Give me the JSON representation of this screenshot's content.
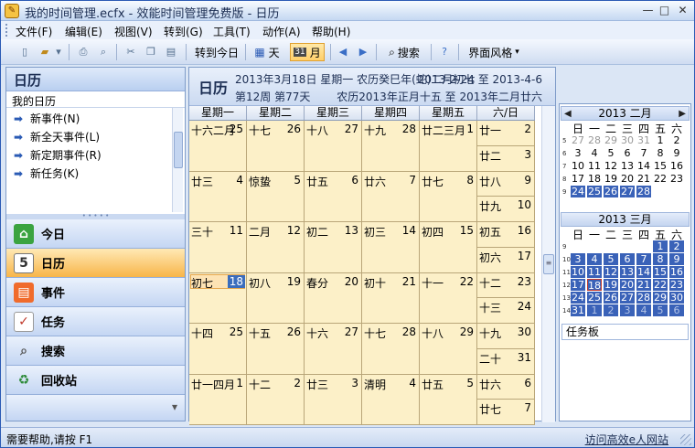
{
  "window": {
    "title": "我的时间管理.ecfx - 效能时间管理免费版 - 日历",
    "min": "—",
    "max": "□",
    "close": "✕"
  },
  "menu": [
    "文件(F)",
    "编辑(E)",
    "视图(V)",
    "转到(G)",
    "工具(T)",
    "动作(A)",
    "帮助(H)"
  ],
  "toolbar": {
    "goto_today": "转到今日",
    "day": "天",
    "month": "月",
    "month_icon": "31",
    "search": "搜索",
    "skin": "界面风格"
  },
  "left": {
    "title": "日历",
    "subtitle": "我的日历",
    "items": [
      "新事件(N)",
      "新全天事件(L)",
      "新定期事件(R)",
      "新任务(K)"
    ],
    "nav": [
      "今日",
      "日历",
      "事件",
      "任务",
      "搜索",
      "回收站"
    ]
  },
  "main": {
    "title": "日历",
    "info1": "2013年3月18日 星期一 农历癸巳年(蛇)二月初七",
    "info2": "第12周 第77天",
    "range": "2013-2-24 至 2013-4-6",
    "lunar_range": "农历2013年正月十五 至 2013年二月廿六",
    "weekdays": [
      "星期一",
      "星期二",
      "星期三",
      "星期四",
      "星期五",
      "六/日"
    ],
    "weeks": [
      {
        "cells": [
          [
            "十六二月",
            "25"
          ],
          [
            "十七",
            "26"
          ],
          [
            "十八",
            "27"
          ],
          [
            "十九",
            "28"
          ],
          [
            "廿二三月",
            "1"
          ]
        ],
        "sat": [
          "廿一",
          "2"
        ],
        "sun": [
          "廿二",
          "3"
        ]
      },
      {
        "cells": [
          [
            "廿三",
            "4"
          ],
          [
            "惊蛰",
            "5"
          ],
          [
            "廿五",
            "6"
          ],
          [
            "廿六",
            "7"
          ],
          [
            "廿七",
            "8"
          ]
        ],
        "sat": [
          "廿八",
          "9"
        ],
        "sun": [
          "廿九",
          "10"
        ]
      },
      {
        "cells": [
          [
            "三十",
            "11"
          ],
          [
            "二月",
            "12"
          ],
          [
            "初二",
            "13"
          ],
          [
            "初三",
            "14"
          ],
          [
            "初四",
            "15"
          ]
        ],
        "sat": [
          "初五",
          "16"
        ],
        "sun": [
          "初六",
          "17"
        ]
      },
      {
        "cells": [
          [
            "初七",
            "18"
          ],
          [
            "初八",
            "19"
          ],
          [
            "春分",
            "20"
          ],
          [
            "初十",
            "21"
          ],
          [
            "十一",
            "22"
          ]
        ],
        "sat": [
          "十二",
          "23"
        ],
        "sun": [
          "十三",
          "24"
        ]
      },
      {
        "cells": [
          [
            "十四",
            "25"
          ],
          [
            "十五",
            "26"
          ],
          [
            "十六",
            "27"
          ],
          [
            "十七",
            "28"
          ],
          [
            "十八",
            "29"
          ]
        ],
        "sat": [
          "十九",
          "30"
        ],
        "sun": [
          "二十",
          "31"
        ]
      },
      {
        "cells": [
          [
            "廿一四月",
            "1"
          ],
          [
            "十二",
            "2"
          ],
          [
            "廿三",
            "3"
          ],
          [
            "清明",
            "4"
          ],
          [
            "廿五",
            "5"
          ]
        ],
        "sat": [
          "廿六",
          "6"
        ],
        "sun": [
          "廿七",
          "7"
        ]
      }
    ]
  },
  "minical": {
    "feb": {
      "title": "2013 二月",
      "prev": "◀",
      "next": "▶",
      "weekdays": [
        "日",
        "一",
        "二",
        "三",
        "四",
        "五",
        "六"
      ],
      "weeks": [
        [
          "5",
          [
            "27",
            "28",
            "29",
            "30",
            "31",
            "1",
            "2"
          ]
        ],
        [
          "6",
          [
            "3",
            "4",
            "5",
            "6",
            "7",
            "8",
            "9"
          ]
        ],
        [
          "7",
          [
            "10",
            "11",
            "12",
            "13",
            "14",
            "15",
            "16"
          ]
        ],
        [
          "8",
          [
            "17",
            "18",
            "19",
            "20",
            "21",
            "22",
            "23"
          ]
        ],
        [
          "9",
          [
            "24",
            "25",
            "26",
            "27",
            "28",
            "",
            ""
          ]
        ]
      ]
    },
    "mar": {
      "title": "2013 三月",
      "weekdays": [
        "日",
        "一",
        "二",
        "三",
        "四",
        "五",
        "六"
      ],
      "weeks": [
        [
          "9",
          [
            "",
            "",
            "",
            "",
            "",
            "1",
            "2"
          ]
        ],
        [
          "10",
          [
            "3",
            "4",
            "5",
            "6",
            "7",
            "8",
            "9"
          ]
        ],
        [
          "11",
          [
            "10",
            "11",
            "12",
            "13",
            "14",
            "15",
            "16"
          ]
        ],
        [
          "12",
          [
            "17",
            "18",
            "19",
            "20",
            "21",
            "22",
            "23"
          ]
        ],
        [
          "13",
          [
            "24",
            "25",
            "26",
            "27",
            "28",
            "29",
            "30"
          ]
        ],
        [
          "14",
          [
            "31",
            "1",
            "2",
            "3",
            "4",
            "5",
            "6"
          ]
        ]
      ]
    },
    "taskboard": "任务板"
  },
  "status": {
    "help": "需要帮助,请按 F1",
    "link": "访问高效e人网站"
  }
}
